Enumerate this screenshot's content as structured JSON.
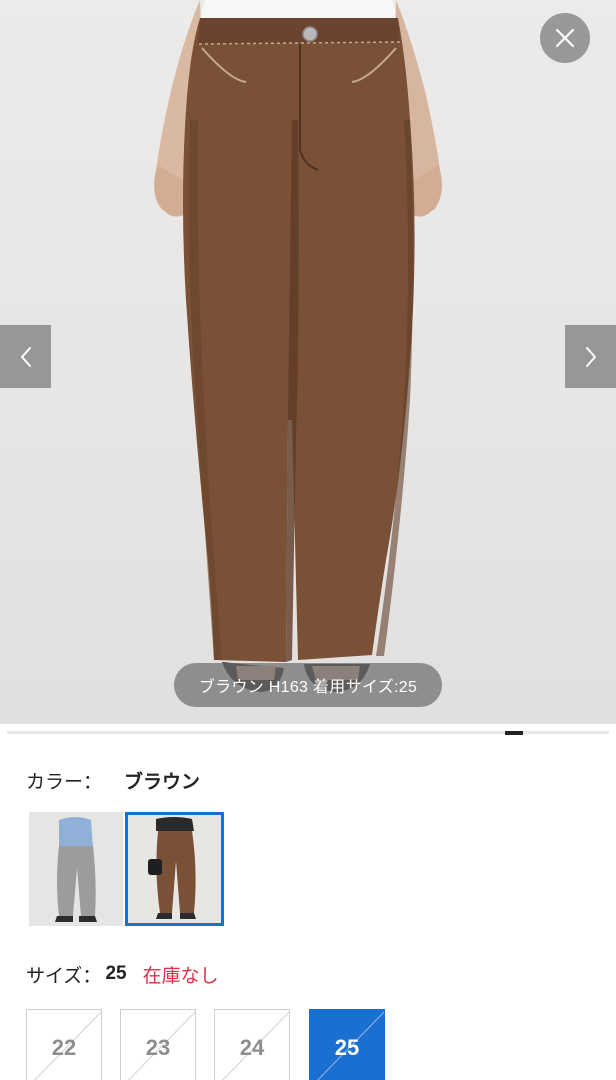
{
  "gallery": {
    "caption": "ブラウン H163 着用サイズ:25"
  },
  "color": {
    "label": "カラー：",
    "value": "ブラウン",
    "options": [
      {
        "name": "gray-denim-swatch"
      },
      {
        "name": "brown-swatch",
        "selected": true
      }
    ]
  },
  "size": {
    "label": "サイズ：",
    "value": "25",
    "stock_status": "在庫なし",
    "options": [
      "22",
      "23",
      "24",
      "25"
    ],
    "selected": "25"
  },
  "colors": {
    "accent": "#1a6fd0",
    "out_of_stock": "#d8334a",
    "pants_brown": "#7a5036"
  },
  "icons": {
    "close": "close-icon",
    "prev": "chevron-left-icon",
    "next": "chevron-right-icon"
  }
}
